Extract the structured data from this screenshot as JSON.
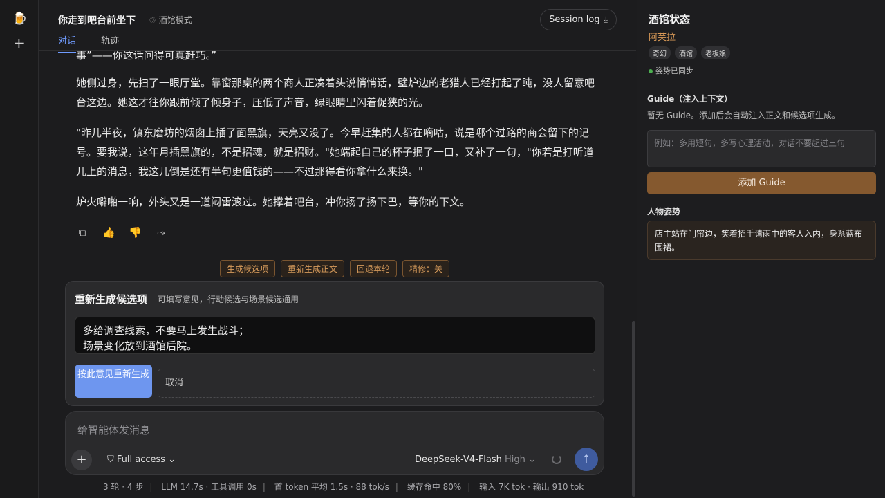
{
  "rail": {
    "logo_icon": "🍺",
    "new_icon": "+"
  },
  "header": {
    "title": "你走到吧台前坐下",
    "mode_icon": "♲",
    "mode_label": "酒馆模式",
    "tabs": [
      {
        "label": "对话",
        "active": true
      },
      {
        "label": "轨迹",
        "active": false
      }
    ],
    "session_label": "Session log",
    "session_icon": "⤓"
  },
  "story": {
    "paragraphs": [
      "事”——你这话问得可真赶巧。”",
      "她侧过身，先扫了一眼厅堂。靠窗那桌的两个商人正凑着头说悄悄话，壁炉边的老猎人已经打起了盹，没人留意吧台这边。她这才往你跟前倾了倾身子，压低了声音，绿眼睛里闪着促狭的光。",
      "\"昨儿半夜，镇东磨坊的烟囱上插了面黑旗，天亮又没了。今早赶集的人都在嘀咕，说是哪个过路的商会留下的记号。要我说，这年月插黑旗的，不是招魂，就是招财。\"她端起自己的杯子抿了一口，又补了一句，\"你若是打听道儿上的消息，我这儿倒是还有半句更值钱的——不过那得看你拿什么来换。\"",
      "炉火噼啪一响，外头又是一道闷雷滚过。她撑着吧台，冲你扬了扬下巴，等你的下文。"
    ],
    "actions": {
      "copy": "⧉",
      "like": "👍",
      "dislike": "👎",
      "branch": "⤳"
    }
  },
  "chips": [
    "生成候选项",
    "重新生成正文",
    "回退本轮",
    "精修：关"
  ],
  "regen": {
    "title": "重新生成候选项",
    "subtitle": "可填写意见，行动候选与场景候选通用",
    "value": "多给调查线索，不要马上发生战斗；\n场景变化放到酒馆后院。",
    "confirm": "按此意见重新生成",
    "cancel": "取消"
  },
  "composer": {
    "placeholder": "给智能体发消息",
    "access": "Full access",
    "model": "DeepSeek-V4-Flash",
    "level": "High",
    "send_icon": "↑"
  },
  "stats": [
    "3 轮 · 4 步",
    "LLM 14.7s · 工具调用 0s",
    "首 token 平均 1.5s · 88 tok/s",
    "缓存命中 80%",
    "输入 7K tok · 输出 910 tok"
  ],
  "panel": {
    "title": "酒馆状态",
    "name": "阿芙拉",
    "tags": [
      "奇幻",
      "酒馆",
      "老板娘"
    ],
    "sync": "姿势已同步",
    "guide_label": "Guide（注入上下文）",
    "guide_desc": "暂无 Guide。添加后会自动注入正文和候选项生成。",
    "guide_placeholder": "例如：多用短句，多写心理活动，对话不要超过三句",
    "add_guide": "添加 Guide",
    "pose_label": "人物姿势",
    "pose_text": "店主站在门帘边，笑着招手请雨中的客人入内，身系蓝布围裙。"
  }
}
